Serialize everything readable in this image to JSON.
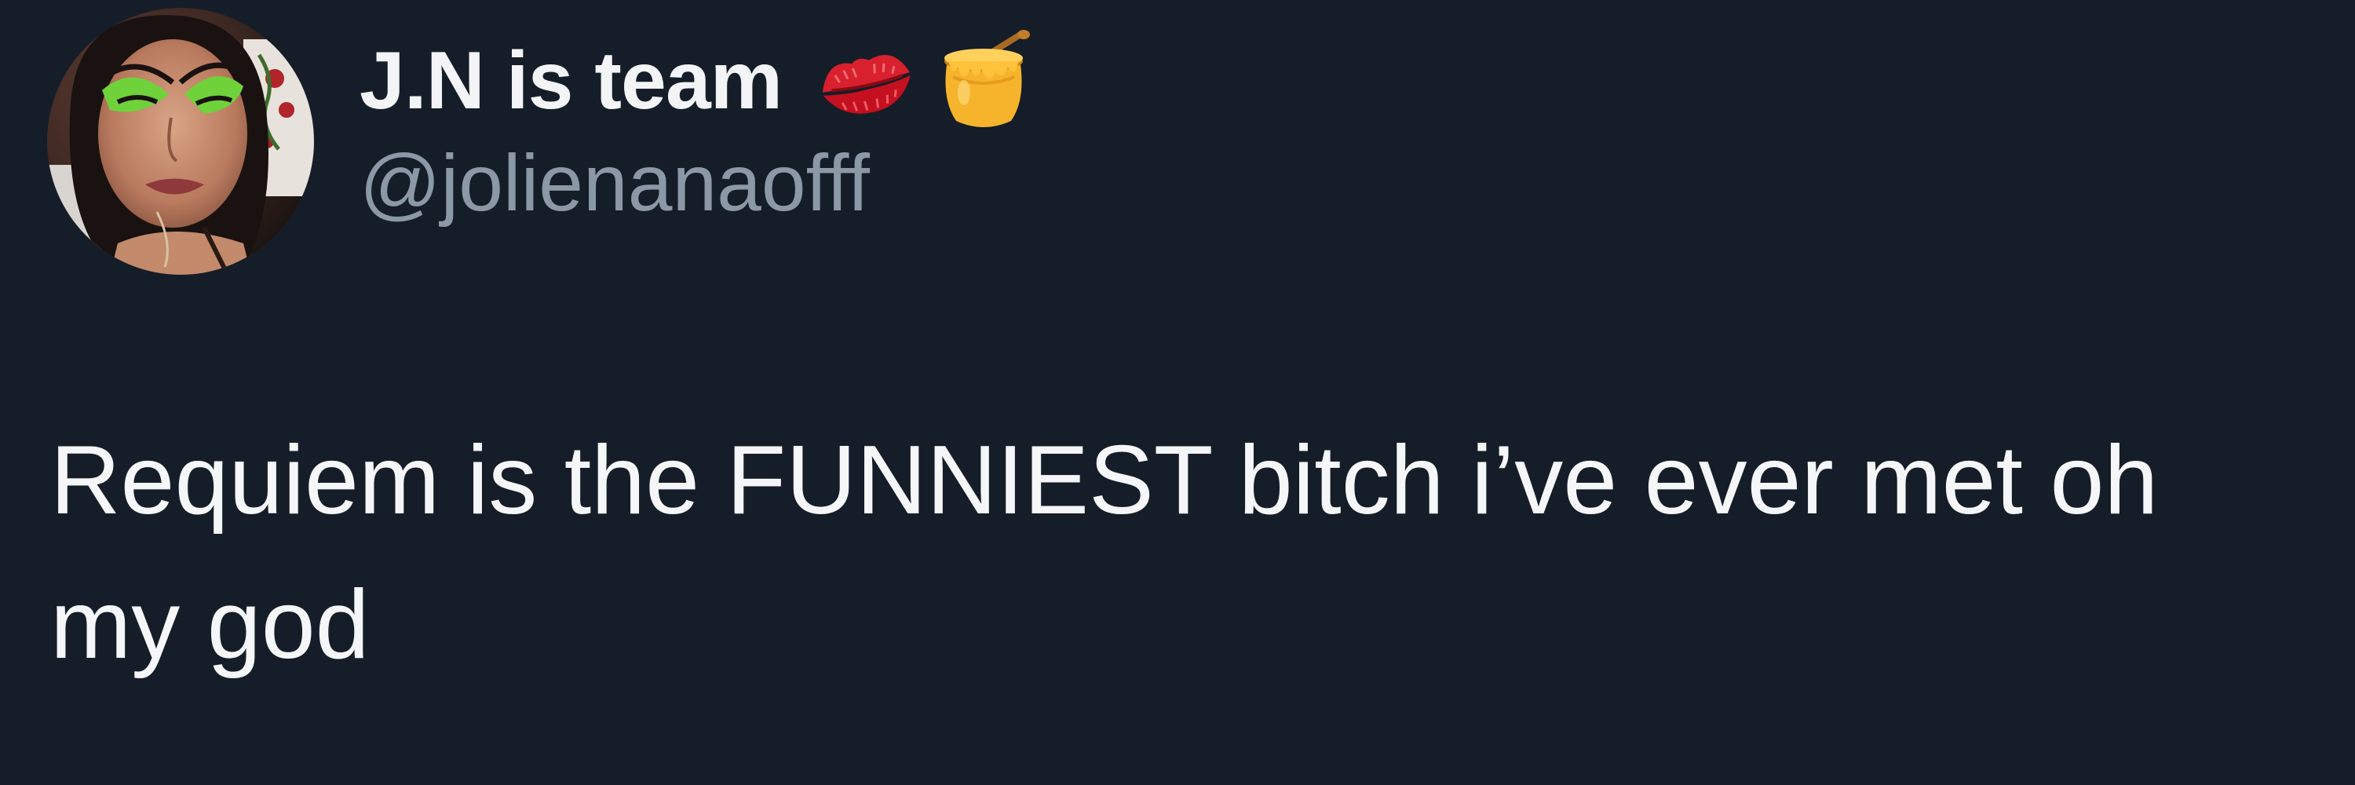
{
  "tweet": {
    "author": {
      "display_name": "J.N is team",
      "handle": "@jolienanaofff",
      "avatar_icon": "profile-photo",
      "name_emojis": [
        "kiss-mark-icon",
        "honey-pot-icon"
      ]
    },
    "text": "Requiem is the FUNNIEST bitch i’ve ever met oh\nmy god"
  },
  "colors": {
    "background": "#151d28",
    "primary_text": "#e7e9ea",
    "secondary_text": "#8b98a5"
  }
}
